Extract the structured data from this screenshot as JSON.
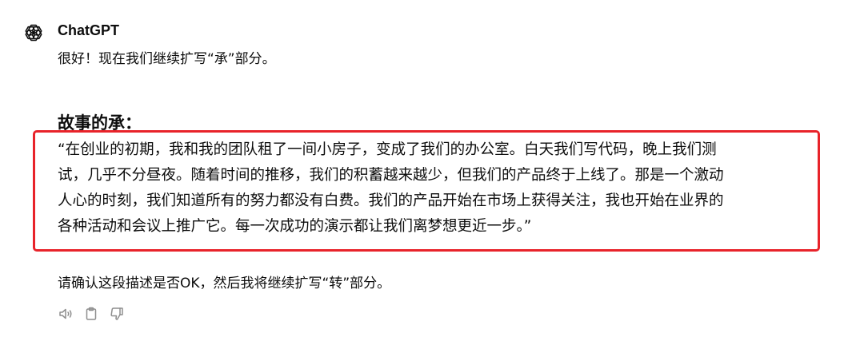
{
  "message": {
    "author": "ChatGPT",
    "avatar_icon": "openai-logo-icon",
    "intro": "很好！现在我们继续扩写“承”部分。",
    "heading": "故事的承：",
    "quote_lines": [
      "“在创业的初期，我和我的团队租了一间小房子，变成了我们的办公室。白天我们写代码，晚上我们测",
      "试，几乎不分昼夜。随着时间的推移，我们的积蓄越来越少，但我们的产品终于上线了。那是一个激动",
      "人心的时刻，我们知道所有的努力都没有白费。我们的产品开始在市场上获得关注，我也开始在业界的",
      "各种活动和会议上推广它。每一次成功的演示都让我们离梦想更近一步。”"
    ],
    "confirm": "请确认这段描述是否OK，然后我将继续扩写“转”部分。"
  },
  "actions": [
    {
      "icon": "speaker-icon"
    },
    {
      "icon": "copy-icon"
    },
    {
      "icon": "thumbs-down-icon"
    }
  ],
  "colors": {
    "highlight_border": "#e8232a",
    "text": "#0d0d0d",
    "icon": "#8e8e8e"
  }
}
